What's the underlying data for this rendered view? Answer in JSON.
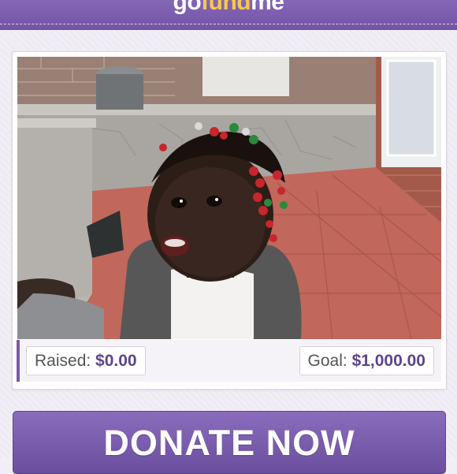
{
  "header": {
    "logo_go": "go",
    "logo_fund": "fund",
    "logo_me": "me"
  },
  "campaign": {
    "photo_alt": "Smiling toddler with beaded braids on a porch",
    "raised_label": "Raised:",
    "raised_value": "$0.00",
    "goal_label": "Goal:",
    "goal_value": "$1,000.00"
  },
  "donate_label": "DONATE NOW",
  "colors": {
    "brand_purple": "#7454a8",
    "logo_accent": "#f7c948",
    "amount_text": "#5d4490"
  }
}
